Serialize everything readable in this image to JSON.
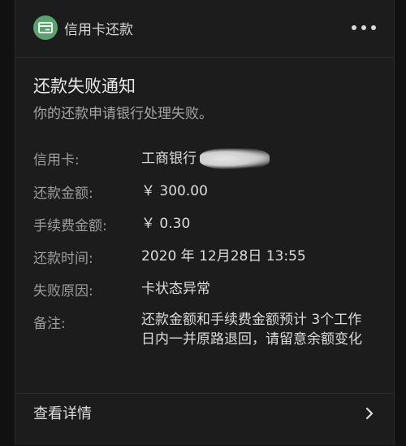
{
  "header": {
    "app_name": "信用卡还款",
    "icon": "credit-card-icon",
    "more_icon": "more-icon"
  },
  "notice": {
    "title": "还款失败通知",
    "subtitle": "你的还款申请银行处理失败。"
  },
  "rows": [
    {
      "label": "信用卡:",
      "value": "工商银行"
    },
    {
      "label": "还款金额:",
      "value": "￥ 300.00"
    },
    {
      "label": "手续费金额:",
      "value": "￥ 0.30"
    },
    {
      "label": "还款时间:",
      "value": "2020 年 12月28日 13:55"
    },
    {
      "label": "失败原因:",
      "value": "卡状态异常"
    },
    {
      "label": "备注:",
      "value": "还款金额和手续费金额预计 3个工作日内一并原路退回，请留意余额变化"
    }
  ],
  "footer": {
    "label": "查看详情",
    "icon": "chevron-right-icon"
  },
  "colors": {
    "background": "#111111",
    "card": "#1c1c1c",
    "accent": "#5aa36f"
  }
}
